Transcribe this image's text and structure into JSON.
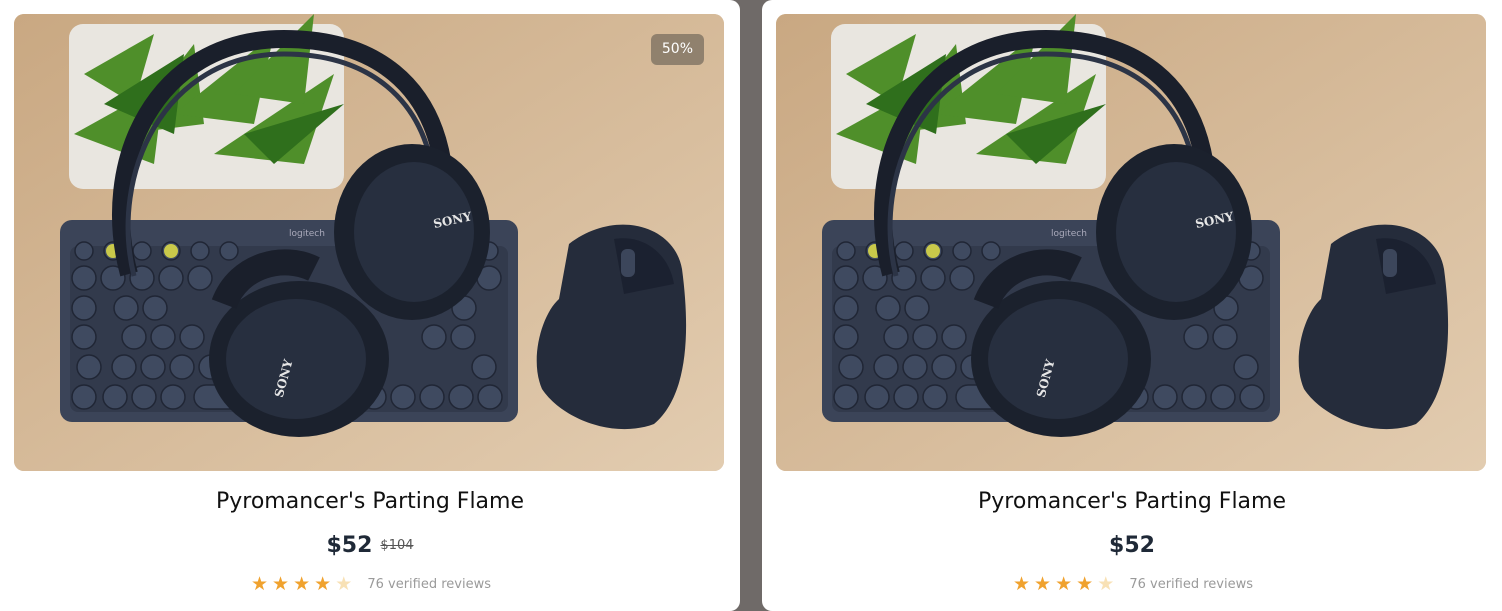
{
  "products": [
    {
      "badge": "50%",
      "title": "Pyromancer's Parting Flame",
      "price": "$52",
      "old_price": "$104",
      "rating": 4,
      "rating_max": 5,
      "reviews": "76 verified reviews"
    },
    {
      "title": "Pyromancer's Parting Flame",
      "price": "$52",
      "rating": 4,
      "rating_max": 5,
      "reviews": "76 verified reviews"
    }
  ],
  "image": {
    "keyboard_brand": "logitech",
    "headphone_brand": "SONY"
  },
  "colors": {
    "star": "#f0a22e",
    "star_empty": "#f8e1b5",
    "price": "#1f2937",
    "backdrop": "#6f6a68"
  }
}
